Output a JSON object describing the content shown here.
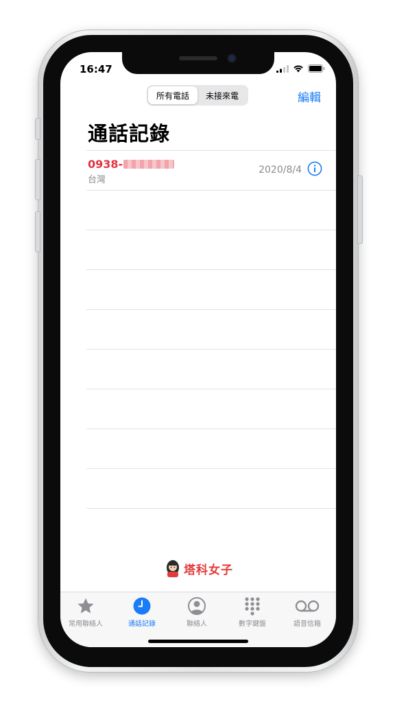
{
  "status_bar": {
    "time": "16:47"
  },
  "segmented": {
    "all_calls": "所有電話",
    "missed": "未接來電"
  },
  "nav": {
    "edit_label": "編輯"
  },
  "page": {
    "title": "通話記錄"
  },
  "calls": [
    {
      "number_prefix": "0938-",
      "region": "台灣",
      "date": "2020/8/4"
    }
  ],
  "watermark": {
    "text": "塔科女子"
  },
  "tabs": [
    {
      "label": "常用聯絡人",
      "icon": "star-icon",
      "active": false
    },
    {
      "label": "通話記錄",
      "icon": "clock-icon",
      "active": true
    },
    {
      "label": "聯絡人",
      "icon": "person-circle-icon",
      "active": false
    },
    {
      "label": "數字鍵盤",
      "icon": "keypad-icon",
      "active": false
    },
    {
      "label": "語音信箱",
      "icon": "voicemail-icon",
      "active": false
    }
  ],
  "colors": {
    "accent": "#1a7cf6",
    "missed_call": "#e3323f",
    "secondary_text": "#8a8a8e"
  }
}
